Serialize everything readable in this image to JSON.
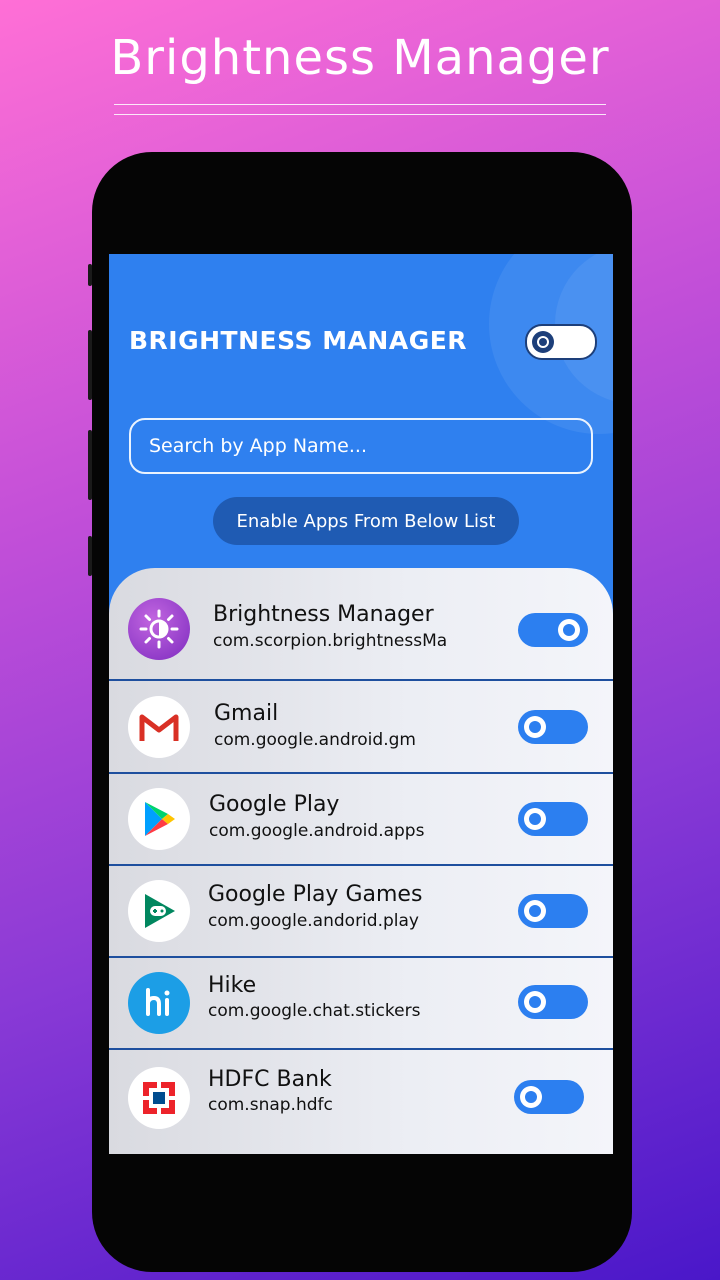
{
  "promo": {
    "title": "Brightness Manager"
  },
  "header": {
    "title": "BRIGHTNESS MANAGER",
    "master_toggle_on": false
  },
  "search": {
    "placeholder": "Search by App Name..."
  },
  "enable_button": {
    "label": "Enable Apps From Below List"
  },
  "apps": [
    {
      "name": "Brightness Manager",
      "package": "com.scorpion.brightnessMa",
      "icon": "brightness-app-icon",
      "enabled": true
    },
    {
      "name": "Gmail",
      "package": "com.google.android.gm",
      "icon": "gmail-icon",
      "enabled": false
    },
    {
      "name": "Google Play",
      "package": "com.google.android.apps",
      "icon": "google-play-icon",
      "enabled": false
    },
    {
      "name": "Google Play Games",
      "package": "com.google.andorid.play",
      "icon": "google-play-games-icon",
      "enabled": false
    },
    {
      "name": "Hike",
      "package": "com.google.chat.stickers",
      "icon": "hike-icon",
      "enabled": false
    },
    {
      "name": "HDFC Bank",
      "package": "com.snap.hdfc",
      "icon": "hdfc-icon",
      "enabled": false
    }
  ],
  "colors": {
    "accent": "#2c7ff0",
    "header_bg": "#2f80ef",
    "button_bg": "#1f5bb3",
    "divider": "#1e4f9e"
  }
}
